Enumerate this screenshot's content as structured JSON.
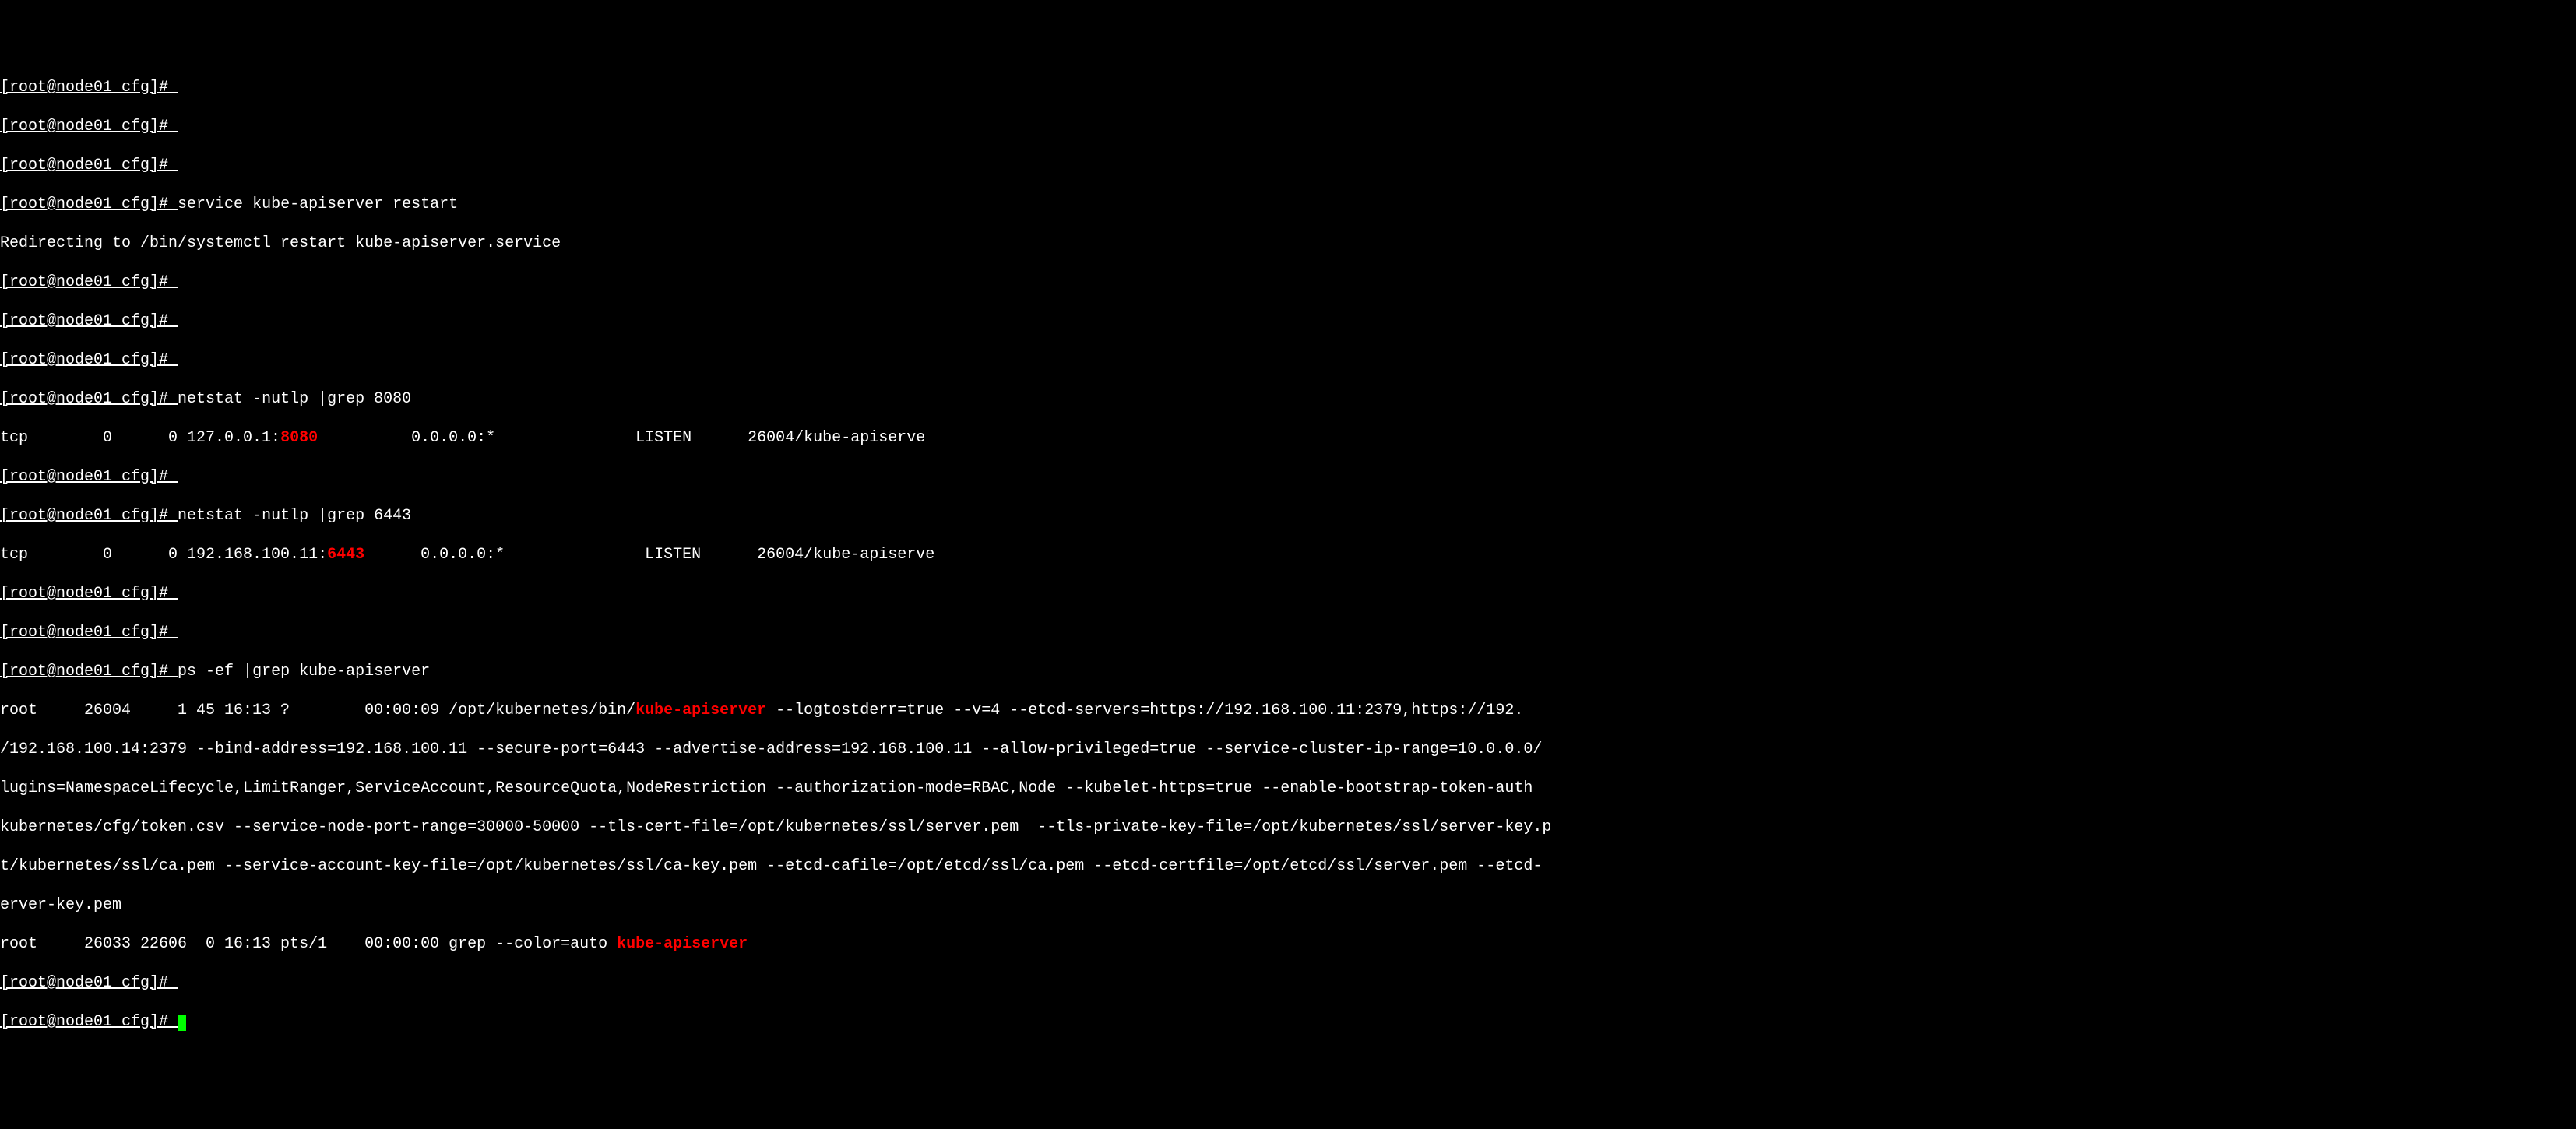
{
  "prompt": "[root@node01 cfg]# ",
  "cmds": {
    "service": "service kube-apiserver restart",
    "netstat1": "netstat -nutlp |grep 8080",
    "netstat2": "netstat -nutlp |grep 6443",
    "ps": "ps -ef |grep kube-apiserver"
  },
  "out": {
    "redirect": "Redirecting to /bin/systemctl restart kube-apiserver.service",
    "net1_a": "tcp        0      0 127.0.0.1:",
    "net1_port": "8080",
    "net1_b": "          0.0.0.0:*               LISTEN      26004/kube-apiserve ",
    "net2_a": "tcp        0      0 192.168.100.11:",
    "net2_port": "6443",
    "net2_b": "      0.0.0.0:*               LISTEN      26004/kube-apiserve ",
    "ps1_a": "root     26004     1 45 16:13 ?        00:00:09 /opt/kubernetes/bin/",
    "ps1_hl": "kube-apiserver",
    "ps1_b": " --logtostderr=true --v=4 --etcd-servers=https://192.168.100.11:2379,https://192.",
    "ps2": "/192.168.100.14:2379 --bind-address=192.168.100.11 --secure-port=6443 --advertise-address=192.168.100.11 --allow-privileged=true --service-cluster-ip-range=10.0.0.0/",
    "ps3": "lugins=NamespaceLifecycle,LimitRanger,ServiceAccount,ResourceQuota,NodeRestriction --authorization-mode=RBAC,Node --kubelet-https=true --enable-bootstrap-token-auth ",
    "ps4": "kubernetes/cfg/token.csv --service-node-port-range=30000-50000 --tls-cert-file=/opt/kubernetes/ssl/server.pem  --tls-private-key-file=/opt/kubernetes/ssl/server-key.p",
    "ps5": "t/kubernetes/ssl/ca.pem --service-account-key-file=/opt/kubernetes/ssl/ca-key.pem --etcd-cafile=/opt/etcd/ssl/ca.pem --etcd-certfile=/opt/etcd/ssl/server.pem --etcd-",
    "ps6": "erver-key.pem",
    "ps7_a": "root     26033 22606  0 16:13 pts/1    00:00:00 grep --color=auto ",
    "ps7_hl": "kube-apiserver"
  }
}
